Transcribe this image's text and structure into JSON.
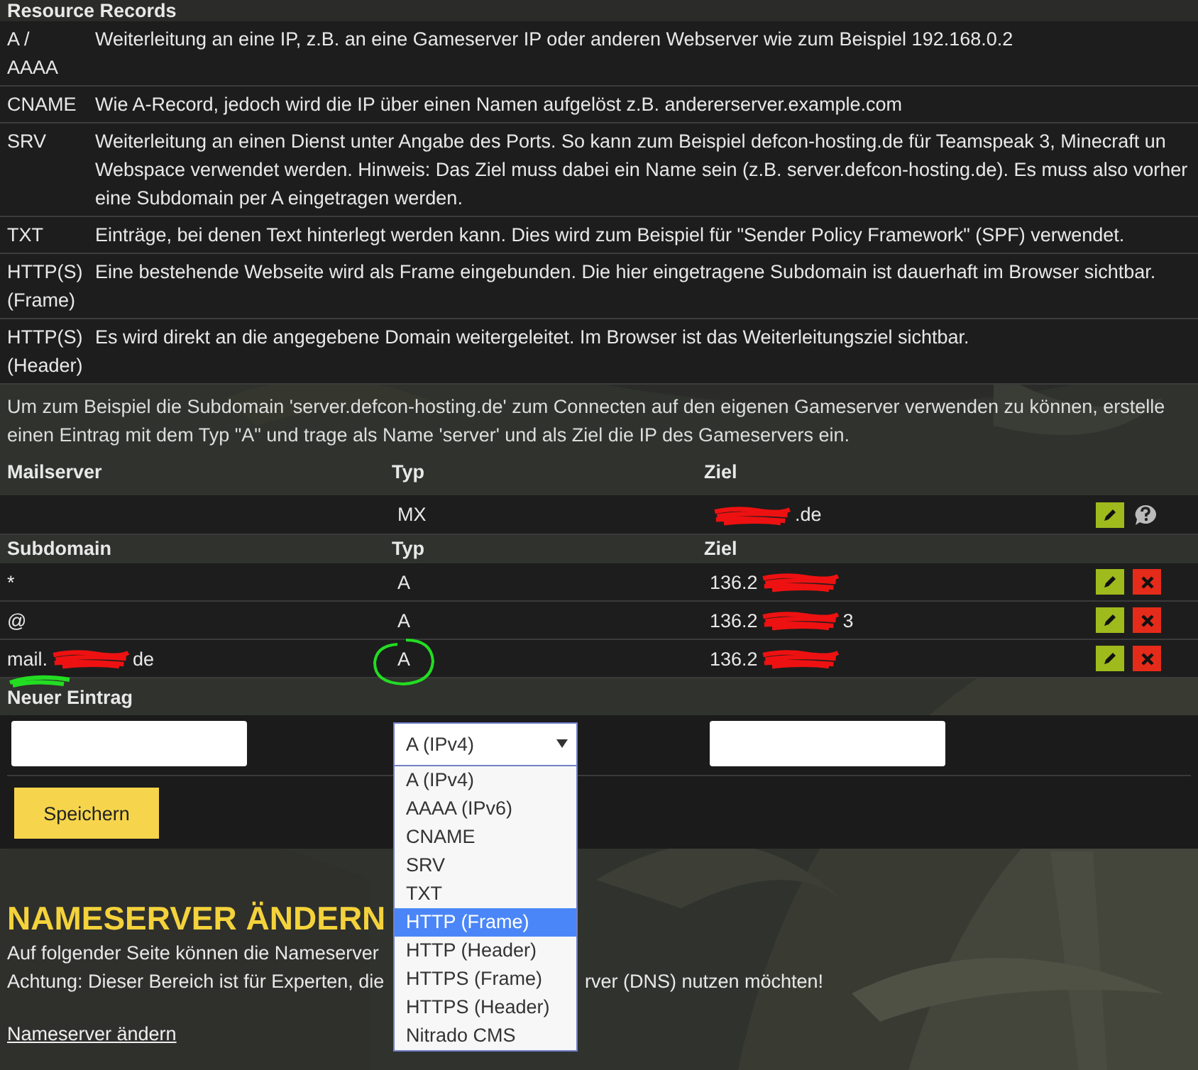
{
  "resource_records": {
    "title": "Resource Records",
    "rows": [
      {
        "type": "A /\nAAAA",
        "description": "Weiterleitung an eine IP, z.B. an eine Gameserver IP oder anderen Webserver wie zum Beispiel 192.168.0.2"
      },
      {
        "type": "CNAME",
        "description": "Wie A-Record, jedoch wird die IP über einen Namen aufgelöst z.B. andererserver.example.com"
      },
      {
        "type": "SRV",
        "description": "Weiterleitung an einen Dienst unter Angabe des Ports. So kann zum Beispiel defcon-hosting.de für Teamspeak 3, Minecraft un\nWebspace verwendet werden. Hinweis: Das Ziel muss dabei ein Name sein (z.B. server.defcon-hosting.de). Es muss also vorher\neine Subdomain per A eingetragen werden."
      },
      {
        "type": "TXT",
        "description": "Einträge, bei denen Text hinterlegt werden kann. Dies wird zum Beispiel für \"Sender Policy Framework\" (SPF) verwendet."
      },
      {
        "type": "HTTP(S)\n(Frame)",
        "description": "Eine bestehende Webseite wird als Frame eingebunden. Die hier eingetragene Subdomain ist dauerhaft im Browser sichtbar."
      },
      {
        "type": "HTTP(S)\n(Header)",
        "description": "Es wird direkt an die angegebene Domain weitergeleitet. Im Browser ist das Weiterleitungsziel sichtbar."
      }
    ]
  },
  "info_text": "Um zum Beispiel die Subdomain 'server.defcon-hosting.de' zum Connecten auf den eigenen Gameserver verwenden zu können, erstelle\neinen Eintrag mit dem Typ \"A\" und trage als Name 'server' und als Ziel die IP des Gameservers ein.",
  "tables": [
    {
      "columns": [
        "Mailserver",
        "Typ",
        "Ziel"
      ],
      "rows": [
        {
          "name": [],
          "type": "MX",
          "target": [
            {
              "kind": "redaction"
            },
            {
              "kind": "text",
              "text": ".de"
            }
          ],
          "annotated": false,
          "actions": [
            {
              "kind": "edit"
            },
            {
              "kind": "help"
            }
          ]
        }
      ]
    },
    {
      "columns": [
        "Subdomain",
        "Typ",
        "Ziel"
      ],
      "rows": [
        {
          "name": [
            {
              "kind": "text",
              "text": "*"
            }
          ],
          "type": "A",
          "target": [
            {
              "kind": "text",
              "text": "136.2"
            },
            {
              "kind": "redaction"
            }
          ],
          "annotated": false,
          "actions": [
            {
              "kind": "edit"
            },
            {
              "kind": "delete"
            }
          ]
        },
        {
          "name": [
            {
              "kind": "text",
              "text": "@"
            }
          ],
          "type": "A",
          "target": [
            {
              "kind": "text",
              "text": "136.2"
            },
            {
              "kind": "redaction"
            },
            {
              "kind": "text",
              "text": "3"
            }
          ],
          "annotated": false,
          "actions": [
            {
              "kind": "edit"
            },
            {
              "kind": "delete"
            }
          ]
        },
        {
          "name": [
            {
              "kind": "text",
              "text": "mail."
            },
            {
              "kind": "redaction"
            },
            {
              "kind": "text",
              "text": "de"
            }
          ],
          "type": "A",
          "target": [
            {
              "kind": "text",
              "text": "136.2"
            },
            {
              "kind": "redaction"
            }
          ],
          "annotated": true,
          "actions": [
            {
              "kind": "edit"
            },
            {
              "kind": "delete"
            }
          ]
        }
      ]
    }
  ],
  "new_entry": {
    "title": "Neuer Eintrag",
    "type_select": {
      "value": "A (IPv4)",
      "expanded": true,
      "options": [
        {
          "label": "A (IPv4)",
          "highlighted": false
        },
        {
          "label": "AAAA (IPv6)",
          "highlighted": false
        },
        {
          "label": "CNAME",
          "highlighted": false
        },
        {
          "label": "SRV",
          "highlighted": false
        },
        {
          "label": "TXT",
          "highlighted": false
        },
        {
          "label": "HTTP (Frame)",
          "highlighted": true
        },
        {
          "label": "HTTP (Header)",
          "highlighted": false
        },
        {
          "label": "HTTPS (Frame)",
          "highlighted": false
        },
        {
          "label": "HTTPS (Header)",
          "highlighted": false
        },
        {
          "label": "Nitrado CMS",
          "highlighted": false
        }
      ]
    },
    "save_button": "Speichern"
  },
  "nameserver": {
    "title": "NAMESERVER ÄNDERN",
    "lines": [
      [
        "Auf folgender Seite können die Nameserver"
      ],
      [
        "Achtung: Dieser Bereich ist für Experten, die",
        "rver (DNS) nutzen möchten!"
      ]
    ],
    "link": "Nameserver ändern"
  }
}
